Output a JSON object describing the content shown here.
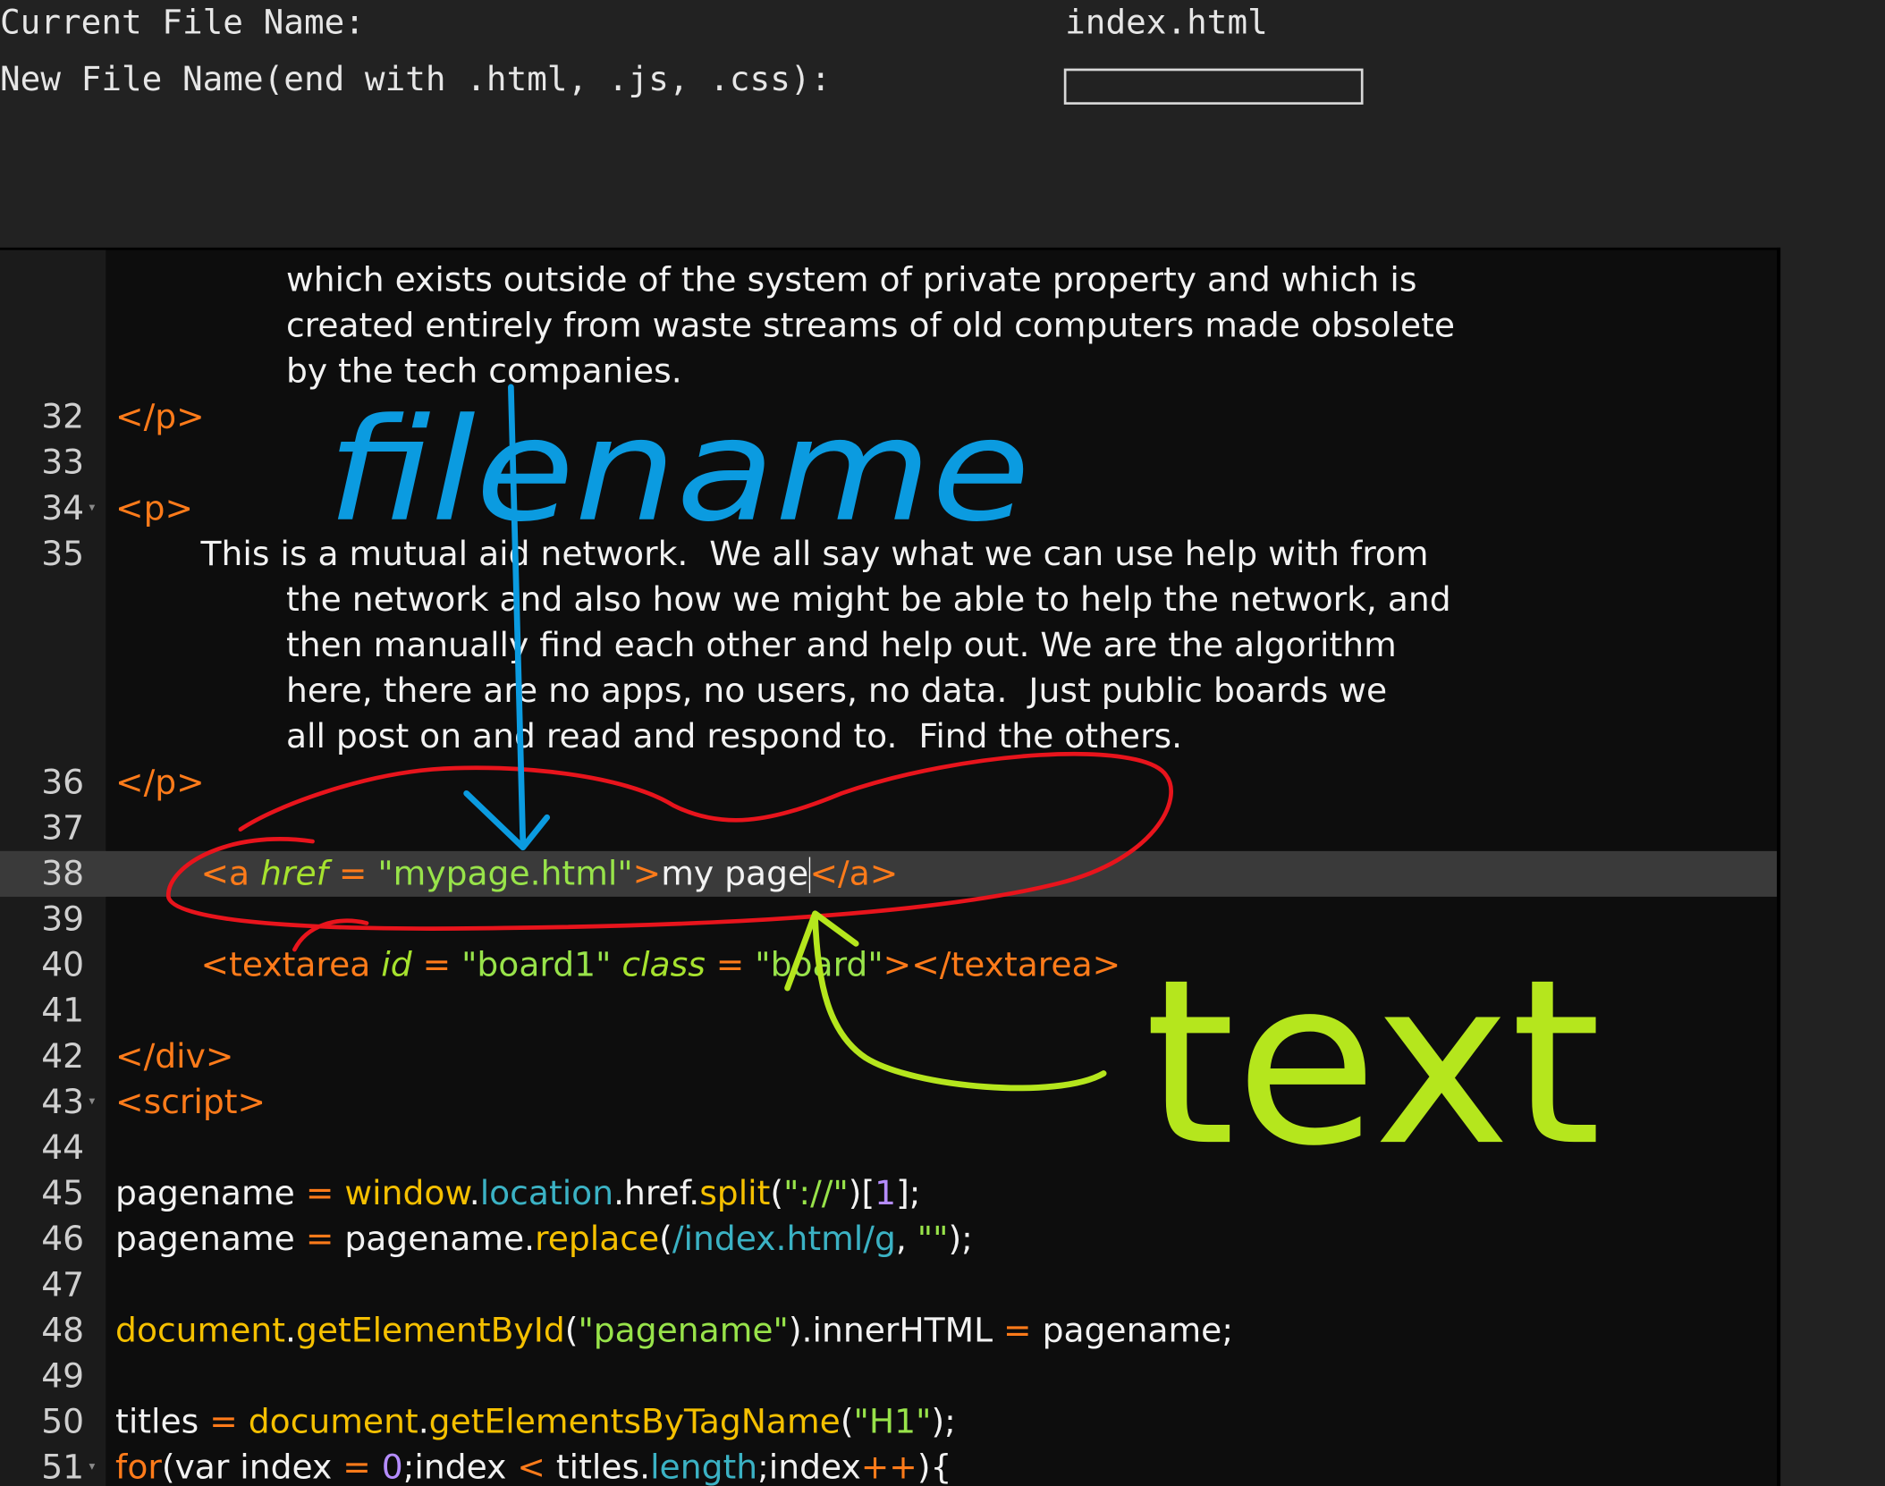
{
  "header": {
    "current_label": "Current File Name:",
    "current_value": "index.html",
    "new_label": "New File Name(end with .html, .js, .css):",
    "new_value": "",
    "new_placeholder": ""
  },
  "editor": {
    "wrapped_text": [
      "which exists outside of the system of private property and which is",
      "created entirely from waste streams of old computers made obsolete",
      "by the tech companies."
    ],
    "lines": [
      {
        "n": "32",
        "tokens": [
          {
            "t": "</p>",
            "c": "tag"
          }
        ]
      },
      {
        "n": "33",
        "tokens": []
      },
      {
        "n": "34",
        "tokens": [
          {
            "t": "<p>",
            "c": "tag"
          }
        ]
      },
      {
        "n": "35",
        "tokens": [
          {
            "t": "This is a mutual aid network.  We all say what we can use help with from",
            "c": "white"
          }
        ]
      },
      {
        "n": "35w1",
        "tokens": [
          {
            "t": "the network and also how we might be able to help the network, and",
            "c": "white"
          }
        ]
      },
      {
        "n": "35w2",
        "tokens": [
          {
            "t": "then manually find each other and help out. We are the algorithm",
            "c": "white"
          }
        ]
      },
      {
        "n": "35w3",
        "tokens": [
          {
            "t": "here, there are no apps, no users, no data.  Just public boards we",
            "c": "white"
          }
        ]
      },
      {
        "n": "35w4",
        "tokens": [
          {
            "t": "all post on and read and respond to.  Find the others.",
            "c": "white"
          }
        ]
      },
      {
        "n": "36",
        "tokens": [
          {
            "t": "</p>",
            "c": "tag"
          }
        ]
      },
      {
        "n": "37",
        "tokens": []
      },
      {
        "n": "38",
        "tokens": [
          {
            "t": "<a ",
            "c": "tag"
          },
          {
            "t": "href",
            "c": "attr"
          },
          {
            "t": " = ",
            "c": "op"
          },
          {
            "t": "\"mypage.html\"",
            "c": "str"
          },
          {
            "t": ">",
            "c": "tag"
          },
          {
            "t": "my page",
            "c": "white"
          },
          {
            "t": "</a>",
            "c": "tag"
          }
        ]
      },
      {
        "n": "39",
        "tokens": []
      },
      {
        "n": "40",
        "tokens": [
          {
            "t": "<textarea ",
            "c": "tag"
          },
          {
            "t": "id",
            "c": "attr"
          },
          {
            "t": " = ",
            "c": "op"
          },
          {
            "t": "\"board1\"",
            "c": "str"
          },
          {
            "t": " ",
            "c": "white"
          },
          {
            "t": "class",
            "c": "attr"
          },
          {
            "t": " = ",
            "c": "op"
          },
          {
            "t": "\"board\"",
            "c": "str"
          },
          {
            "t": "></textarea>",
            "c": "tag"
          }
        ]
      },
      {
        "n": "41",
        "tokens": []
      },
      {
        "n": "42",
        "tokens": [
          {
            "t": "</div>",
            "c": "tag"
          }
        ]
      },
      {
        "n": "43",
        "tokens": [
          {
            "t": "<script>",
            "c": "tag"
          }
        ]
      },
      {
        "n": "44",
        "tokens": []
      },
      {
        "n": "45",
        "tokens": [
          {
            "t": "pagename ",
            "c": "white"
          },
          {
            "t": "=",
            "c": "op"
          },
          {
            "t": " ",
            "c": "white"
          },
          {
            "t": "window",
            "c": "fn"
          },
          {
            "t": ".",
            "c": "white"
          },
          {
            "t": "location",
            "c": "prop"
          },
          {
            "t": ".href.",
            "c": "white"
          },
          {
            "t": "split",
            "c": "fn"
          },
          {
            "t": "(",
            "c": "white"
          },
          {
            "t": "\"://\"",
            "c": "str"
          },
          {
            "t": ")[",
            "c": "white"
          },
          {
            "t": "1",
            "c": "num"
          },
          {
            "t": "];",
            "c": "white"
          }
        ]
      },
      {
        "n": "46",
        "tokens": [
          {
            "t": "pagename ",
            "c": "white"
          },
          {
            "t": "=",
            "c": "op"
          },
          {
            "t": " pagename.",
            "c": "white"
          },
          {
            "t": "replace",
            "c": "fn"
          },
          {
            "t": "(",
            "c": "white"
          },
          {
            "t": "/index.html/g",
            "c": "prop"
          },
          {
            "t": ", ",
            "c": "white"
          },
          {
            "t": "\"\"",
            "c": "str"
          },
          {
            "t": ");",
            "c": "white"
          }
        ]
      },
      {
        "n": "47",
        "tokens": []
      },
      {
        "n": "48",
        "tokens": [
          {
            "t": "document",
            "c": "fn"
          },
          {
            "t": ".",
            "c": "white"
          },
          {
            "t": "getElementById",
            "c": "fn"
          },
          {
            "t": "(",
            "c": "white"
          },
          {
            "t": "\"pagename\"",
            "c": "str"
          },
          {
            "t": ").innerHTML ",
            "c": "white"
          },
          {
            "t": "=",
            "c": "op"
          },
          {
            "t": " pagename;",
            "c": "white"
          }
        ]
      },
      {
        "n": "49",
        "tokens": []
      },
      {
        "n": "50",
        "tokens": [
          {
            "t": "titles ",
            "c": "white"
          },
          {
            "t": "=",
            "c": "op"
          },
          {
            "t": " ",
            "c": "white"
          },
          {
            "t": "document",
            "c": "fn"
          },
          {
            "t": ".",
            "c": "white"
          },
          {
            "t": "getElementsByTagName",
            "c": "fn"
          },
          {
            "t": "(",
            "c": "white"
          },
          {
            "t": "\"H1\"",
            "c": "str"
          },
          {
            "t": ");",
            "c": "white"
          }
        ]
      },
      {
        "n": "51",
        "tokens": [
          {
            "t": "for",
            "c": "kw"
          },
          {
            "t": "(var index ",
            "c": "white"
          },
          {
            "t": "=",
            "c": "op"
          },
          {
            "t": " ",
            "c": "white"
          },
          {
            "t": "0",
            "c": "num"
          },
          {
            "t": ";index ",
            "c": "white"
          },
          {
            "t": "<",
            "c": "op"
          },
          {
            "t": " titles.",
            "c": "white"
          },
          {
            "t": "length",
            "c": "prop"
          },
          {
            "t": ";index",
            "c": "white"
          },
          {
            "t": "++",
            "c": "op"
          },
          {
            "t": "){",
            "c": "white"
          }
        ]
      }
    ]
  },
  "annotations": {
    "blue_word": "filename",
    "green_word": "text",
    "blue_color": "#0b9be0",
    "green_color": "#b5e61d",
    "red_color": "#e8141c"
  },
  "colors": {
    "background": "#222222",
    "editor_bg": "#0d0d0d",
    "gutter_bg": "#1b1b1b",
    "tag": "#ff7b1a",
    "string": "#98e34a",
    "function": "#f5c000",
    "property": "#3bb2c4"
  }
}
